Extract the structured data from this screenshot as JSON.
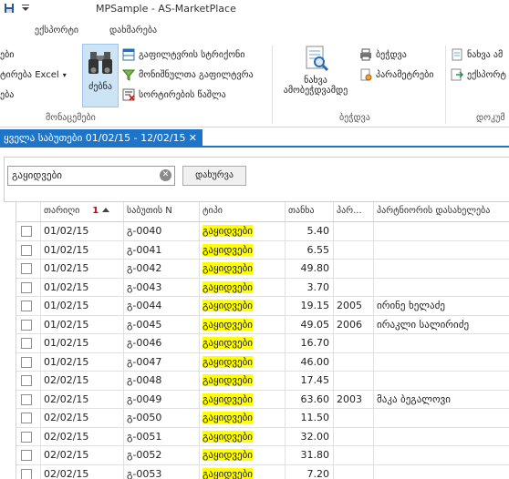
{
  "window": {
    "title": "MPSample - AS-MarketPlace"
  },
  "menu": {
    "items": [
      "ექსპორტი",
      "დახმარება"
    ]
  },
  "ribbon": {
    "left_partial": {
      "row1": "ები",
      "row2": "ტირება Excel",
      "row3": "ება"
    },
    "find_label": "ძებნა",
    "filter_items": [
      "გაფილტვრის სტრიქონი",
      "მონიშნულთა გაფილტვრა",
      "სორტირების წაშლა"
    ],
    "search_group_label": "მონაცემები",
    "print_big_label1": "ნახვა",
    "print_big_label2": "ამობეჭდვამდე",
    "print_items": [
      "ბეჭდვა",
      "პარამეტრები"
    ],
    "print_group_label": "ბეჭდვა",
    "doc_items": [
      "ნახვა ამ",
      "ექსპორტ"
    ],
    "doc_group_label": "დოკუმ"
  },
  "tab": {
    "label": "ყველა საბუთები 01/02/15 - 12/02/15",
    "close": "✕"
  },
  "filter": {
    "value": "გაყიდვები",
    "close_button": "დახურვა"
  },
  "grid": {
    "headers": {
      "date": "თარიღი",
      "sort_index": "1",
      "doc_num": "საბუთის N",
      "type": "ტიპი",
      "amount": "თანხა",
      "partner_code": "პარ...",
      "partner_name": "პარტნიორის დასახელება"
    },
    "rows": [
      {
        "date": "01/02/15",
        "num": "გ-0040",
        "type": "გაყიდვები",
        "amount": "5.40",
        "code": "",
        "partner": ""
      },
      {
        "date": "01/02/15",
        "num": "გ-0041",
        "type": "გაყიდვები",
        "amount": "6.55",
        "code": "",
        "partner": ""
      },
      {
        "date": "01/02/15",
        "num": "გ-0042",
        "type": "გაყიდვები",
        "amount": "49.80",
        "code": "",
        "partner": ""
      },
      {
        "date": "01/02/15",
        "num": "გ-0043",
        "type": "გაყიდვები",
        "amount": "3.70",
        "code": "",
        "partner": ""
      },
      {
        "date": "01/02/15",
        "num": "გ-0044",
        "type": "გაყიდვები",
        "amount": "19.15",
        "code": "2005",
        "partner": "ირინე ხელაძე"
      },
      {
        "date": "01/02/15",
        "num": "გ-0045",
        "type": "გაყიდვები",
        "amount": "49.05",
        "code": "2006",
        "partner": "ირაკლი სალირიძე"
      },
      {
        "date": "01/02/15",
        "num": "გ-0046",
        "type": "გაყიდვები",
        "amount": "16.70",
        "code": "",
        "partner": ""
      },
      {
        "date": "01/02/15",
        "num": "გ-0047",
        "type": "გაყიდვები",
        "amount": "46.00",
        "code": "",
        "partner": ""
      },
      {
        "date": "02/02/15",
        "num": "გ-0048",
        "type": "გაყიდვები",
        "amount": "17.45",
        "code": "",
        "partner": ""
      },
      {
        "date": "02/02/15",
        "num": "გ-0049",
        "type": "გაყიდვები",
        "amount": "63.60",
        "code": "2003",
        "partner": "მაკა ბეგალოვი"
      },
      {
        "date": "02/02/15",
        "num": "გ-0050",
        "type": "გაყიდვები",
        "amount": "11.50",
        "code": "",
        "partner": ""
      },
      {
        "date": "02/02/15",
        "num": "გ-0051",
        "type": "გაყიდვები",
        "amount": "32.00",
        "code": "",
        "partner": ""
      },
      {
        "date": "02/02/15",
        "num": "გ-0052",
        "type": "გაყიდვები",
        "amount": "31.80",
        "code": "",
        "partner": ""
      },
      {
        "date": "02/02/15",
        "num": "გ-0053",
        "type": "გაყიდვები",
        "amount": "7.20",
        "code": "",
        "partner": ""
      }
    ]
  },
  "colors": {
    "accent": "#1e75c8",
    "highlight": "#ffff00",
    "sort_indicator": "#d00000"
  }
}
